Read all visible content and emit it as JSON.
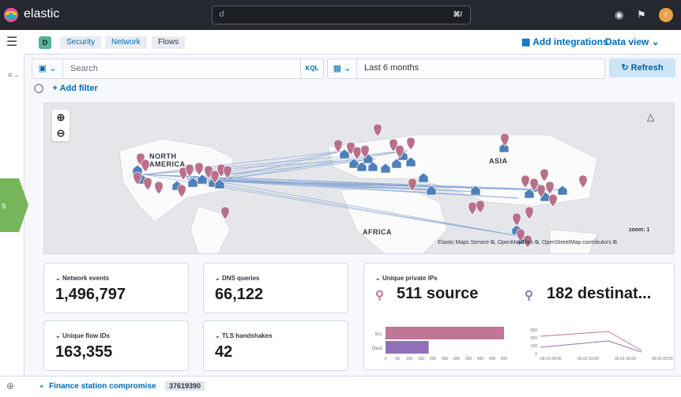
{
  "app": {
    "brand": "elastic",
    "search_shortcut": "⌘/"
  },
  "header": {
    "space_badge": "D",
    "breadcrumbs": [
      "Security",
      "Network",
      "Flows"
    ],
    "add_integrations": "Add integrations",
    "data_view": "Data view"
  },
  "query": {
    "placeholder": "Search",
    "language": "KQL",
    "date_range": "Last 6 months",
    "refresh": "Refresh",
    "add_filter": "+ Add filter"
  },
  "map": {
    "labels": {
      "north_america": "NORTH AMERICA",
      "asia": "ASIA",
      "africa": "AFRICA"
    },
    "zoom_text": "zoom: 1",
    "attribution": "Elastic Maps Service ⧉, OpenMapTiles ⧉, OpenStreetMap contributors ⧉",
    "colors": {
      "pin": "#b8708a",
      "building": "#4f7fb9",
      "line": "#8aa8d4"
    }
  },
  "stats": {
    "network_events": {
      "label": "Network events",
      "value": "1,496,797"
    },
    "dns_queries": {
      "label": "DNS queries",
      "value": "66,122"
    },
    "unique_flow_ids": {
      "label": "Unique flow IDs",
      "value": "163,355"
    },
    "tls_handshakes": {
      "label": "TLS handshakes",
      "value": "42"
    },
    "unique_private_ips": {
      "label": "Unique private IPs",
      "source": "511 source",
      "destination": "182 destinat..."
    }
  },
  "bar_chart": {
    "categories": [
      "Src.",
      "Dest."
    ],
    "values": [
      511,
      182
    ],
    "colors": [
      "#c17597",
      "#9170b8"
    ],
    "x_ticks": [
      "0",
      "50",
      "100",
      "150",
      "200",
      "250",
      "300",
      "350",
      "400",
      "450",
      "500"
    ]
  },
  "line_chart": {
    "y_ticks": [
      "300",
      "200",
      "100",
      "0"
    ],
    "x_ticks": [
      "06-01 00:00",
      "06-01 03:00",
      "06-01 06:00",
      "06-01 09:00"
    ],
    "series": [
      {
        "color": "#c17597"
      },
      {
        "color": "#9170b8"
      }
    ]
  },
  "bottom": {
    "timeline": "Finance station compromise",
    "count": "37619390"
  },
  "side_tab": {
    "label": "s"
  }
}
